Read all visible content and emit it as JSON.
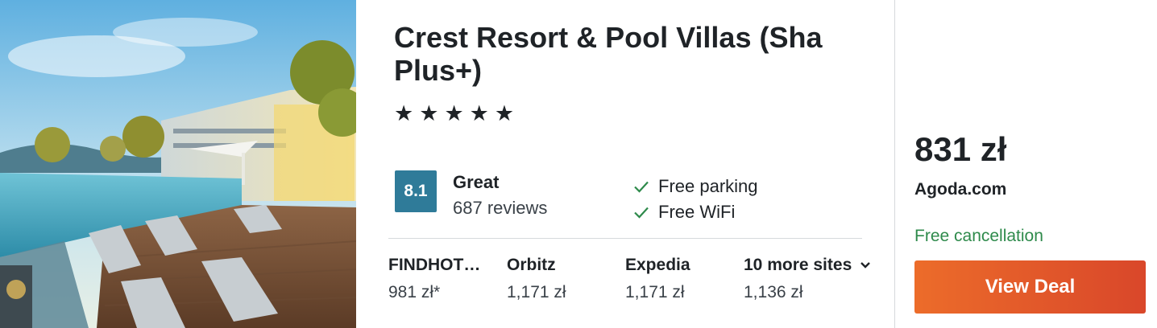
{
  "hotel": {
    "name": "Crest Resort & Pool Villas (Sha Plus+)",
    "star_rating": 5,
    "stars": [
      "★",
      "★",
      "★",
      "★",
      "★"
    ]
  },
  "rating": {
    "score": "8.1",
    "label": "Great",
    "reviews": "687 reviews"
  },
  "amenities": [
    {
      "icon": "check-icon",
      "label": "Free parking"
    },
    {
      "icon": "check-icon",
      "label": "Free WiFi"
    }
  ],
  "sites": [
    {
      "name": "FINDHOT…",
      "price": "981 zł*"
    },
    {
      "name": "Orbitz",
      "price": "1,171 zł"
    },
    {
      "name": "Expedia",
      "price": "1,171 zł"
    },
    {
      "name": "10 more sites",
      "price": "1,136 zł",
      "icon": "chevron-down-icon"
    }
  ],
  "deal": {
    "price": "831 zł",
    "provider": "Agoda.com",
    "cancellation": "Free cancellation",
    "button_label": "View Deal"
  },
  "colors": {
    "score_badge": "#2f7b99",
    "check": "#2e8a4b",
    "free_cancellation": "#2e8a4b",
    "button_start": "#ec6c2a",
    "button_end": "#d9472a"
  }
}
